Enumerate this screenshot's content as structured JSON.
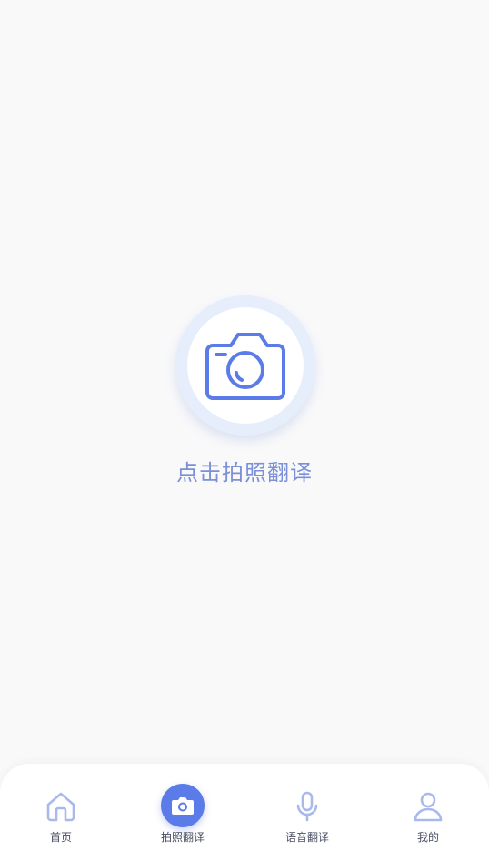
{
  "main": {
    "capture_label": "点击拍照翻译"
  },
  "colors": {
    "accent": "#5b7ce8",
    "label_blue": "#7b90d6",
    "icon_inactive": "#a9b9ec"
  },
  "tab_bar": {
    "tabs": [
      {
        "label": "首页",
        "icon": "home-icon",
        "active": false
      },
      {
        "label": "拍照翻译",
        "icon": "camera-icon",
        "active": true
      },
      {
        "label": "语音翻译",
        "icon": "microphone-icon",
        "active": false
      },
      {
        "label": "我的",
        "icon": "user-icon",
        "active": false
      }
    ]
  }
}
